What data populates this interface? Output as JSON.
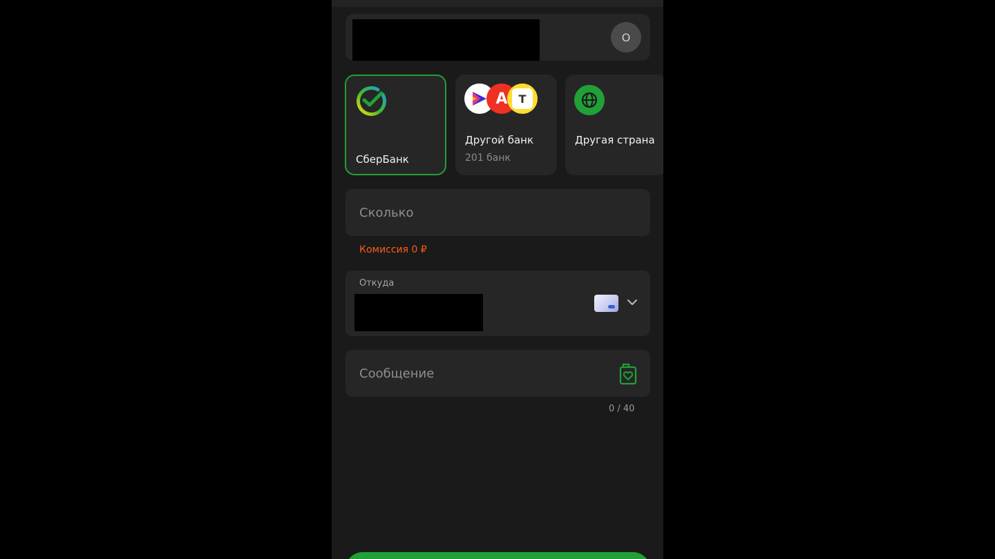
{
  "recipient": {
    "avatar_initial": "О"
  },
  "banks": [
    {
      "title": "СберБанк",
      "subtitle": "",
      "selected": true
    },
    {
      "title": "Другой банк",
      "subtitle": "201 банк",
      "selected": false
    },
    {
      "title": "Другая страна",
      "subtitle": "",
      "selected": false
    }
  ],
  "amount": {
    "placeholder": "Сколько",
    "commission": "Комиссия 0 ₽"
  },
  "from": {
    "label": "Откуда"
  },
  "message": {
    "placeholder": "Сообщение",
    "counter": "0 / 40"
  },
  "colors": {
    "accent": "#21a038",
    "commission": "#ff5a1f",
    "background": "#1a1a1a",
    "surface": "#262626"
  },
  "icons": {
    "sber": "sber-logo-icon",
    "other_bank": "bank-logos-icon",
    "other_country": "globe-icon",
    "card": "card-icon",
    "chevron": "chevron-down-icon",
    "message": "gift-card-icon"
  }
}
